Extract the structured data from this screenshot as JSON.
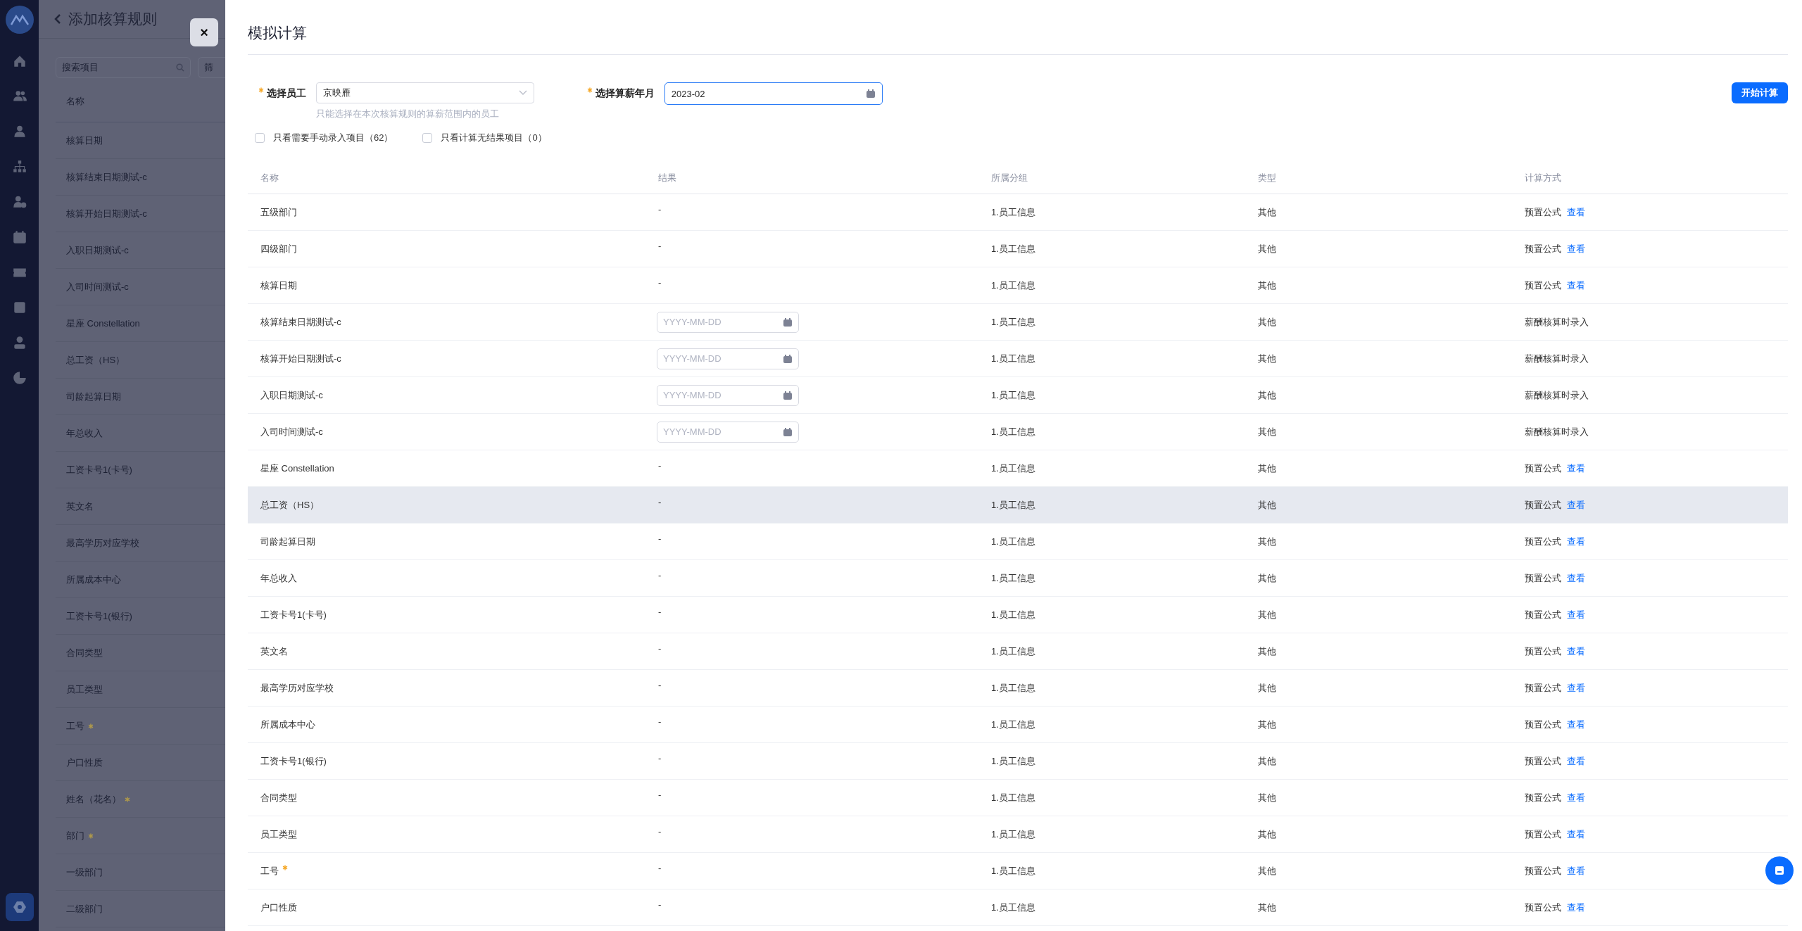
{
  "background_page": {
    "title": "添加核算规则",
    "search": {
      "placeholder": "搜索项目"
    },
    "filter": {
      "placeholder": "筛"
    },
    "column": "名称",
    "rows": [
      {
        "name": "核算日期",
        "required": false
      },
      {
        "name": "核算结束日期测试-c",
        "required": false
      },
      {
        "name": "核算开始日期测试-c",
        "required": false
      },
      {
        "name": "入职日期测试-c",
        "required": false
      },
      {
        "name": "入司时间测试-c",
        "required": false
      },
      {
        "name": "星座 Constellation",
        "required": false
      },
      {
        "name": "总工资（HS）",
        "required": false
      },
      {
        "name": "司龄起算日期",
        "required": false
      },
      {
        "name": "年总收入",
        "required": false
      },
      {
        "name": "工资卡号1(卡号)",
        "required": false
      },
      {
        "name": "英文名",
        "required": false
      },
      {
        "name": "最高学历对应学校",
        "required": false
      },
      {
        "name": "所属成本中心",
        "required": false
      },
      {
        "name": "工资卡号1(银行)",
        "required": false
      },
      {
        "name": "合同类型",
        "required": false
      },
      {
        "name": "员工类型",
        "required": false
      },
      {
        "name": "工号",
        "required": true
      },
      {
        "name": "户口性质",
        "required": false
      },
      {
        "name": "姓名（花名）",
        "required": true
      },
      {
        "name": "部门",
        "required": true
      },
      {
        "name": "一级部门",
        "required": false
      },
      {
        "name": "二级部门",
        "required": false
      }
    ]
  },
  "close_button": "×",
  "drawer": {
    "title": "模拟计算",
    "employee": {
      "label": "选择员工",
      "required": true,
      "value": "京映雁",
      "hint": "只能选择在本次核算规则的算薪范围内的员工"
    },
    "month": {
      "label": "选择算薪年月",
      "required": true,
      "value": "2023-02",
      "focused": true
    },
    "start_button": "开始计算",
    "filters": [
      {
        "label": "只看需要手动录入项目（62）",
        "checked": false
      },
      {
        "label": "只看计算无结果项目（0）",
        "checked": false
      }
    ],
    "columns": [
      "名称",
      "结果",
      "所属分组",
      "类型",
      "计算方式"
    ],
    "rows": [
      {
        "name": "五级部门",
        "required": false,
        "kind": "text",
        "result": "-",
        "group": "1.员工信息",
        "type": "其他",
        "method": "预置公式",
        "link": "查看",
        "highlighted": false
      },
      {
        "name": "四级部门",
        "required": false,
        "kind": "text",
        "result": "-",
        "group": "1.员工信息",
        "type": "其他",
        "method": "预置公式",
        "link": "查看",
        "highlighted": false
      },
      {
        "name": "核算日期",
        "required": false,
        "kind": "text",
        "result": "-",
        "group": "1.员工信息",
        "type": "其他",
        "method": "预置公式",
        "link": "查看",
        "highlighted": false
      },
      {
        "name": "核算结束日期测试-c",
        "required": false,
        "kind": "date",
        "placeholder": "YYYY-MM-DD",
        "group": "1.员工信息",
        "type": "其他",
        "method": "薪酬核算时录入",
        "highlighted": false
      },
      {
        "name": "核算开始日期测试-c",
        "required": false,
        "kind": "date",
        "placeholder": "YYYY-MM-DD",
        "group": "1.员工信息",
        "type": "其他",
        "method": "薪酬核算时录入",
        "highlighted": false
      },
      {
        "name": "入职日期测试-c",
        "required": false,
        "kind": "date",
        "placeholder": "YYYY-MM-DD",
        "group": "1.员工信息",
        "type": "其他",
        "method": "薪酬核算时录入",
        "highlighted": false
      },
      {
        "name": "入司时间测试-c",
        "required": false,
        "kind": "date",
        "placeholder": "YYYY-MM-DD",
        "group": "1.员工信息",
        "type": "其他",
        "method": "薪酬核算时录入",
        "highlighted": false
      },
      {
        "name": "星座 Constellation",
        "required": false,
        "kind": "text",
        "result": "-",
        "group": "1.员工信息",
        "type": "其他",
        "method": "预置公式",
        "link": "查看",
        "highlighted": false
      },
      {
        "name": "总工资（HS）",
        "required": false,
        "kind": "text",
        "result": "-",
        "group": "1.员工信息",
        "type": "其他",
        "method": "预置公式",
        "link": "查看",
        "highlighted": true
      },
      {
        "name": "司龄起算日期",
        "required": false,
        "kind": "text",
        "result": "-",
        "group": "1.员工信息",
        "type": "其他",
        "method": "预置公式",
        "link": "查看",
        "highlighted": false
      },
      {
        "name": "年总收入",
        "required": false,
        "kind": "text",
        "result": "-",
        "group": "1.员工信息",
        "type": "其他",
        "method": "预置公式",
        "link": "查看",
        "highlighted": false
      },
      {
        "name": "工资卡号1(卡号)",
        "required": false,
        "kind": "text",
        "result": "-",
        "group": "1.员工信息",
        "type": "其他",
        "method": "预置公式",
        "link": "查看",
        "highlighted": false
      },
      {
        "name": "英文名",
        "required": false,
        "kind": "text",
        "result": "-",
        "group": "1.员工信息",
        "type": "其他",
        "method": "预置公式",
        "link": "查看",
        "highlighted": false
      },
      {
        "name": "最高学历对应学校",
        "required": false,
        "kind": "text",
        "result": "-",
        "group": "1.员工信息",
        "type": "其他",
        "method": "预置公式",
        "link": "查看",
        "highlighted": false
      },
      {
        "name": "所属成本中心",
        "required": false,
        "kind": "text",
        "result": "-",
        "group": "1.员工信息",
        "type": "其他",
        "method": "预置公式",
        "link": "查看",
        "highlighted": false
      },
      {
        "name": "工资卡号1(银行)",
        "required": false,
        "kind": "text",
        "result": "-",
        "group": "1.员工信息",
        "type": "其他",
        "method": "预置公式",
        "link": "查看",
        "highlighted": false
      },
      {
        "name": "合同类型",
        "required": false,
        "kind": "text",
        "result": "-",
        "group": "1.员工信息",
        "type": "其他",
        "method": "预置公式",
        "link": "查看",
        "highlighted": false
      },
      {
        "name": "员工类型",
        "required": false,
        "kind": "text",
        "result": "-",
        "group": "1.员工信息",
        "type": "其他",
        "method": "预置公式",
        "link": "查看",
        "highlighted": false
      },
      {
        "name": "工号",
        "required": true,
        "kind": "text",
        "result": "-",
        "group": "1.员工信息",
        "type": "其他",
        "method": "预置公式",
        "link": "查看",
        "highlighted": false
      },
      {
        "name": "户口性质",
        "required": false,
        "kind": "text",
        "result": "-",
        "group": "1.员工信息",
        "type": "其他",
        "method": "预置公式",
        "link": "查看",
        "highlighted": false
      }
    ]
  }
}
